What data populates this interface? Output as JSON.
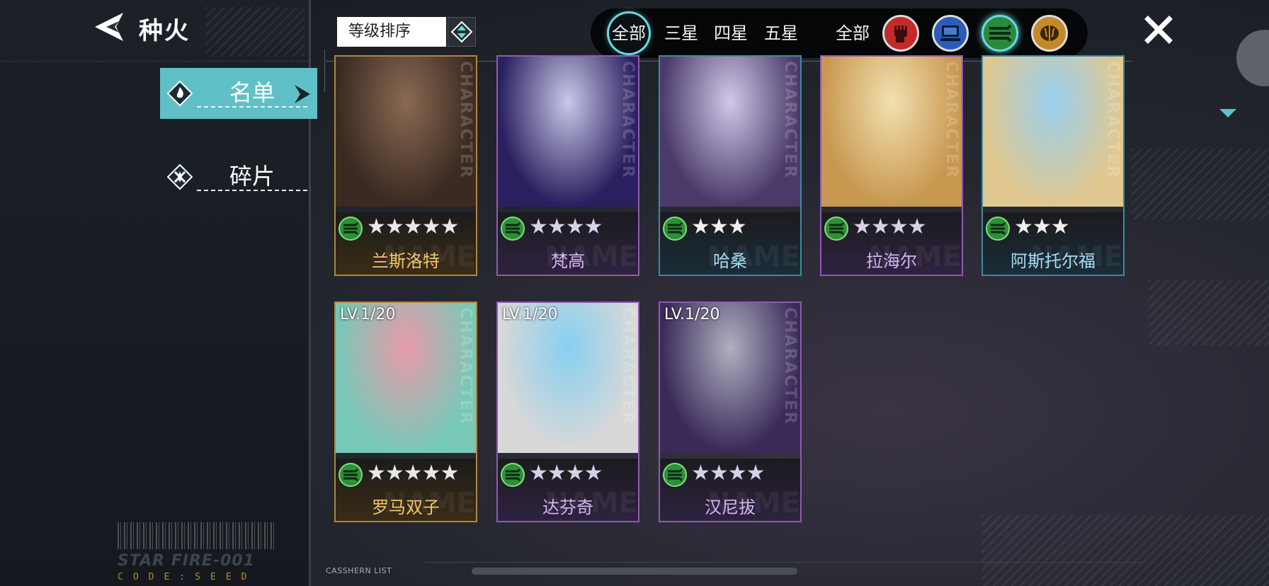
{
  "header": {
    "title": "种火"
  },
  "sidebar": {
    "items": [
      {
        "label": "名单",
        "active": true,
        "icon": "flame-diamond-icon"
      },
      {
        "label": "碎片",
        "active": false,
        "icon": "shard-diamond-icon"
      }
    ]
  },
  "sort": {
    "label": "等级排序"
  },
  "filters": {
    "rarity": [
      "全部",
      "三星",
      "四星",
      "五星"
    ],
    "type_all": "全部",
    "types": [
      {
        "icon": "fist-icon",
        "color": "#c42a2a"
      },
      {
        "icon": "computer-icon",
        "color": "#2a5db5"
      },
      {
        "icon": "speed-lines-icon",
        "color": "#2a8a3a"
      },
      {
        "icon": "brain-icon",
        "color": "#c48a2a"
      }
    ],
    "selected_rarity": "全部",
    "selected_type_index": 2
  },
  "card_watermark": "CHARACTER",
  "card_name_watermark": "NAME",
  "characters": [
    {
      "name": "兰斯洛特",
      "stars": 5,
      "rarity": "gold",
      "level": "",
      "colors": [
        "#3a2a22",
        "#8a6a52"
      ]
    },
    {
      "name": "梵高",
      "stars": 4,
      "rarity": "purple",
      "level": "",
      "colors": [
        "#2a2060",
        "#c8c8e8"
      ]
    },
    {
      "name": "哈桑",
      "stars": 3,
      "rarity": "blue",
      "level": "",
      "colors": [
        "#4a3a6a",
        "#d0c8e8"
      ]
    },
    {
      "name": "拉海尔",
      "stars": 4,
      "rarity": "purple",
      "level": "",
      "colors": [
        "#c89850",
        "#f2e0b0"
      ]
    },
    {
      "name": "阿斯托尔福",
      "stars": 3,
      "rarity": "blue",
      "level": "",
      "colors": [
        "#e0c890",
        "#9ad0f0"
      ]
    },
    {
      "name": "罗马双子",
      "stars": 5,
      "rarity": "gold",
      "level": "LV.1/20",
      "colors": [
        "#78c8b8",
        "#e89aa8"
      ]
    },
    {
      "name": "达芬奇",
      "stars": 4,
      "rarity": "purple",
      "level": "LV.1/20",
      "colors": [
        "#d8d8d8",
        "#88d0f0"
      ]
    },
    {
      "name": "汉尼拔",
      "stars": 4,
      "rarity": "purple",
      "level": "LV.1/20",
      "colors": [
        "#3a2a5a",
        "#b0b0c0"
      ]
    }
  ],
  "footer": {
    "code_top": "STAR FIRE-001",
    "code_bottom": "CODE:SEED",
    "list_label": "CASSHERN LIST"
  }
}
